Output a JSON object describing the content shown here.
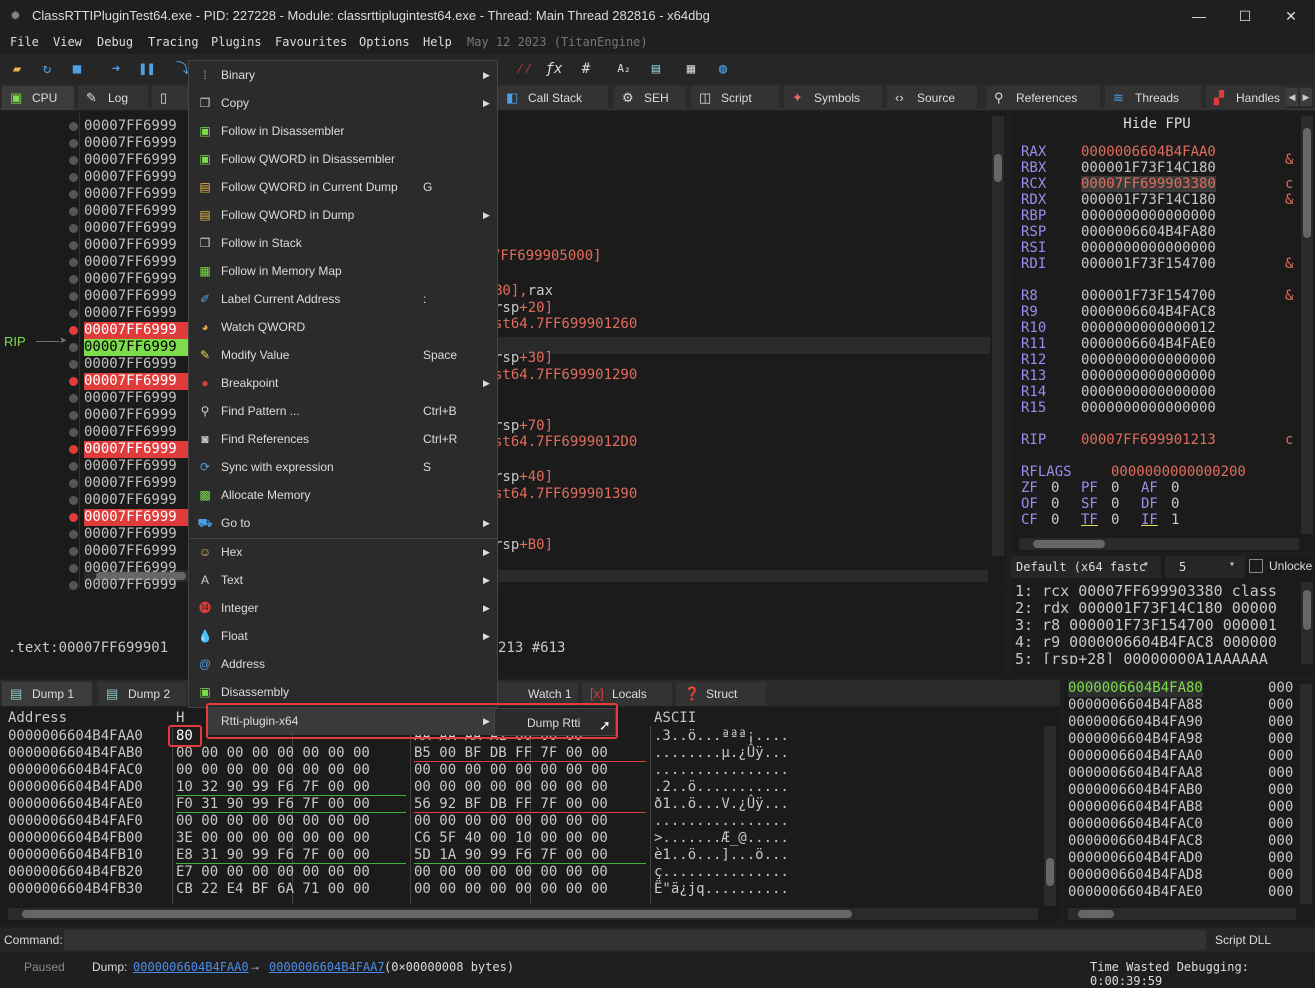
{
  "title": "ClassRTTIPluginTest64.exe - PID: 227228 - Module: classrttiplugintest64.exe - Thread: Main Thread 282816 - x64dbg",
  "window_controls": {
    "minimize": "—",
    "maximize": "☐",
    "close": "✕"
  },
  "menu": [
    "File",
    "View",
    "Debug",
    "Tracing",
    "Plugins",
    "Favourites",
    "Options",
    "Help"
  ],
  "build_date": "May 12 2023 (TitanEngine)",
  "tabs": [
    "CPU",
    "Log",
    "Call Stack",
    "SEH",
    "Script",
    "Symbols",
    "Source",
    "References",
    "Threads",
    "Handles"
  ],
  "disasm": {
    "rip_label": "RIP",
    "addresses": [
      "00007FF6999",
      "00007FF6999",
      "00007FF6999",
      "00007FF6999",
      "00007FF6999",
      "00007FF6999",
      "00007FF6999",
      "00007FF6999",
      "00007FF6999",
      "00007FF6999",
      "00007FF6999",
      "00007FF6999",
      "00007FF6999",
      "00007FF6999",
      "00007FF6999",
      "00007FF6999",
      "00007FF6999",
      "00007FF6999",
      "00007FF6999",
      "00007FF6999",
      "00007FF6999",
      "00007FF6999",
      "00007FF6999",
      "00007FF6999",
      "00007FF6999",
      "00007FF6999",
      "00007FF6999",
      "00007FF6999"
    ],
    "ins1": "7FF699905000]",
    "ins2a": "B0],",
    "ins2b": "rax",
    "ins3a": "rsp",
    "ins3b": "+20]",
    "ins4": "st64.7FF699901260",
    "ins5a": "rsp",
    "ins5b": "+30]",
    "ins6": "st64.7FF699901290",
    "ins7a": "rsp",
    "ins7b": "+70]",
    "ins8": "st64.7FF6999012D0",
    "ins9a": "rsp",
    "ins9b": "+40]",
    "ins10": "st64.7FF699901390",
    "ins11a": "rsp",
    "ins11b": "+B0]"
  },
  "info_line": ".text:00007FF699901",
  "info_tail": "213 #613",
  "registers": {
    "hide_fpu": "Hide FPU",
    "gp": [
      [
        "RAX",
        "0000006604B4FAA0"
      ],
      [
        "RBX",
        "000001F73F14C180"
      ],
      [
        "RCX",
        "00007FF699903380"
      ],
      [
        "RDX",
        "000001F73F14C180"
      ],
      [
        "RBP",
        "0000000000000000"
      ],
      [
        "RSP",
        "0000006604B4FA80"
      ],
      [
        "RSI",
        "0000000000000000"
      ],
      [
        "RDI",
        "000001F73F154700"
      ]
    ],
    "ext": [
      [
        "R8",
        "000001F73F154700"
      ],
      [
        "R9",
        "0000006604B4FAC8"
      ],
      [
        "R10",
        "0000000000000012"
      ],
      [
        "R11",
        "0000006604B4FAE0"
      ],
      [
        "R12",
        "0000000000000000"
      ],
      [
        "R13",
        "0000000000000000"
      ],
      [
        "R14",
        "0000000000000000"
      ],
      [
        "R15",
        "0000000000000000"
      ]
    ],
    "rip": [
      "RIP",
      "00007FF699901213"
    ],
    "rflags": [
      "RFLAGS",
      "0000000000000200"
    ],
    "flags": [
      [
        "ZF",
        "0"
      ],
      [
        "PF",
        "0"
      ],
      [
        "AF",
        "0"
      ],
      [
        "OF",
        "0"
      ],
      [
        "SF",
        "0"
      ],
      [
        "DF",
        "0"
      ],
      [
        "CF",
        "0"
      ],
      [
        "TF",
        "0"
      ],
      [
        "IF",
        "1"
      ]
    ],
    "side": [
      "&",
      "&",
      "c",
      "&",
      "&",
      "&",
      "c"
    ]
  },
  "callconv": {
    "label": "Default (x64 fastc",
    "count": "5",
    "unlock": "Unlocke"
  },
  "args": [
    "1: rcx 00007FF699903380 class",
    "2: rdx 000001F73F14C180 00000",
    "3: r8 000001F73F154700 000001",
    "4: r9 0000006604B4FAC8 000000",
    "5: [rsp+28] 00000000A1AAAAAA"
  ],
  "dump_tabs": [
    "Dump 1",
    "Dump 2",
    "Watch 1",
    "Locals",
    "Struct"
  ],
  "dump": {
    "header_addr": "Address",
    "header_hex": "H",
    "header_ascii": "ASCII",
    "rows": [
      [
        "0000006604B4FAA0",
        "80",
        "",
        "AA AA AA A1 00 00 00",
        ".3..ö...ªªª¡...."
      ],
      [
        "0000006604B4FAB0",
        "00 00 00 00 00 00 00 00",
        "",
        "B5 00 BF DB FF 7F 00 00",
        "........µ.¿Ûÿ..."
      ],
      [
        "0000006604B4FAC0",
        "00 00 00 00 00 00 00 00",
        "",
        "00 00 00 00 00 00 00 00",
        "................"
      ],
      [
        "0000006604B4FAD0",
        "10 32 90 99 F6 7F 00 00",
        "",
        "00 00 00 00 00 00 00 00",
        ".2..ö..........."
      ],
      [
        "0000006604B4FAE0",
        "F0 31 90 99 F6 7F 00 00",
        "",
        "56 92 BF DB FF 7F 00 00",
        "ð1..ö...V.¿Ûÿ..."
      ],
      [
        "0000006604B4FAF0",
        "00 00 00 00 00 00 00 00",
        "",
        "00 00 00 00 00 00 00 00",
        "................"
      ],
      [
        "0000006604B4FB00",
        "3E 00 00 00 00 00 00 00",
        "",
        "C6 5F 40 00 10 00 00 00",
        ">.......Æ_@....."
      ],
      [
        "0000006604B4FB10",
        "E8 31 90 99 F6 7F 00 00",
        "",
        "5D 1A 90 99 F6 7F 00 00",
        "è1..ö...]...ö..."
      ],
      [
        "0000006604B4FB20",
        "E7 00 00 00 00 00 00 00",
        "",
        "00 00 00 00 00 00 00 00",
        "ç..............."
      ],
      [
        "0000006604B4FB30",
        "CB 22 E4 BF 6A 71 00 00",
        "",
        "00 00 00 00 00 00 00 00",
        "Ë\"ä¿jq.........."
      ]
    ]
  },
  "stack": [
    "0000006604B4FA80",
    "0000006604B4FA88",
    "0000006604B4FA90",
    "0000006604B4FA98",
    "0000006604B4FAA0",
    "0000006604B4FAA8",
    "0000006604B4FAB0",
    "0000006604B4FAB8",
    "0000006604B4FAC0",
    "0000006604B4FAC8",
    "0000006604B4FAD0",
    "0000006604B4FAD8",
    "0000006604B4FAE0"
  ],
  "stack_val": "000",
  "context_menu": [
    {
      "label": "Binary",
      "arrow": true,
      "icon": "binary-icon"
    },
    {
      "label": "Copy",
      "arrow": true,
      "icon": "copy-icon"
    },
    {
      "label": "Follow in Disassembler",
      "icon": "disasm-icon"
    },
    {
      "label": "Follow QWORD in Disassembler",
      "icon": "disasm-icon"
    },
    {
      "label": "Follow QWORD in Current Dump",
      "shortcut": "G",
      "icon": "dump-icon"
    },
    {
      "label": "Follow QWORD in Dump",
      "arrow": true,
      "icon": "dump-icon"
    },
    {
      "label": "Follow in Stack",
      "icon": "stack-icon"
    },
    {
      "label": "Follow in Memory Map",
      "icon": "memmap-icon"
    },
    {
      "label": "Label Current Address",
      "shortcut": ":",
      "icon": "label-icon"
    },
    {
      "label": "Watch QWORD",
      "icon": "watch-icon"
    },
    {
      "label": "Modify Value",
      "shortcut": "Space",
      "icon": "pencil-icon"
    },
    {
      "label": "Breakpoint",
      "arrow": true,
      "icon": "breakpoint-icon"
    },
    {
      "label": "Find Pattern ...",
      "shortcut": "Ctrl+B",
      "icon": "search-icon"
    },
    {
      "label": "Find References",
      "shortcut": "Ctrl+R",
      "icon": "binoculars-icon"
    },
    {
      "label": "Sync with expression",
      "shortcut": "S",
      "icon": "sync-icon"
    },
    {
      "label": "Allocate Memory",
      "icon": "allocate-icon"
    },
    {
      "label": "Go to",
      "arrow": true,
      "icon": "goto-icon"
    },
    {
      "label": "Hex",
      "arrow": true,
      "icon": "hex-icon"
    },
    {
      "label": "Text",
      "arrow": true,
      "icon": "text-icon"
    },
    {
      "label": "Integer",
      "arrow": true,
      "icon": "integer-icon"
    },
    {
      "label": "Float",
      "arrow": true,
      "icon": "float-icon"
    },
    {
      "label": "Address",
      "icon": "address-icon"
    },
    {
      "label": "Disassembly",
      "icon": "disassembly-icon"
    },
    {
      "label": "Rtti-plugin-x64",
      "arrow": true,
      "icon": ""
    }
  ],
  "submenu": "Dump Rtti",
  "command": {
    "label": "Command:",
    "script": "Script DLL"
  },
  "status": {
    "state": "Paused",
    "dump_label": "Dump:",
    "from": "0000006604B4FAA0",
    "arrow": "→",
    "to": "0000006604B4FAA7",
    "bytes": "(0×00000008 bytes)",
    "time": "Time Wasted Debugging: 0:00:39:59"
  },
  "colors": {
    "accent": "#e03c3c",
    "rip": "#7cdc4c",
    "reg": "#9c8cf0"
  }
}
